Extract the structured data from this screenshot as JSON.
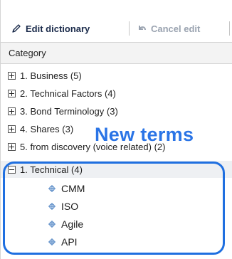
{
  "toolbar": {
    "edit_label": "Edit dictionary",
    "edit_icon": "pencil-icon",
    "cancel_label": "Cancel edit",
    "cancel_icon": "undo-icon"
  },
  "table": {
    "column_header": "Category"
  },
  "tree": {
    "categories": [
      {
        "label": "1. Business (5)",
        "expanded": false
      },
      {
        "label": "2. Technical Factors (4)",
        "expanded": false
      },
      {
        "label": "3. Bond Terminology (3)",
        "expanded": false
      },
      {
        "label": "4. Shares (3)",
        "expanded": false
      },
      {
        "label": "5. from discovery (voice related) (2)",
        "expanded": false
      },
      {
        "label": "1. Technical (4)",
        "expanded": true
      }
    ],
    "terms": [
      "CMM",
      "ISO",
      "Agile",
      "API"
    ]
  },
  "annotation": {
    "text": "New terms",
    "color": "#2a74e6"
  },
  "colors": {
    "accent": "#1f6fe0",
    "selected_row": "#eef0f3",
    "header_bg": "#f3f3f3"
  }
}
